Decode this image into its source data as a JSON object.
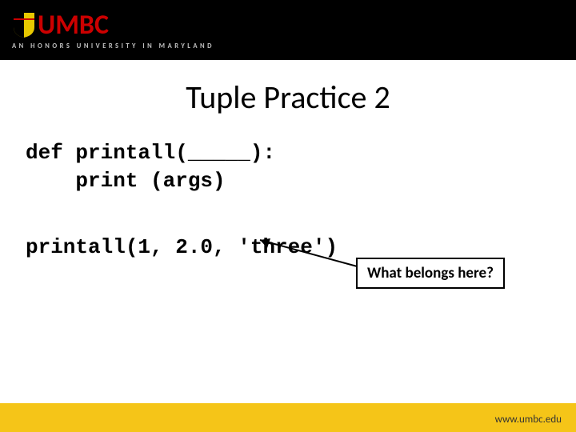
{
  "header": {
    "logo": "UMBC",
    "tagline": "AN HONORS UNIVERSITY IN MARYLAND"
  },
  "slide": {
    "title": "Tuple Practice 2",
    "code_line1_a": "def printall(",
    "code_line1_blank": "_____",
    "code_line1_b": "):",
    "code_line2": "    print (args)",
    "callout": "What belongs here?",
    "code_line3": "printall(1, 2.0, 'three')"
  },
  "footer": {
    "url": "www.umbc.edu"
  }
}
